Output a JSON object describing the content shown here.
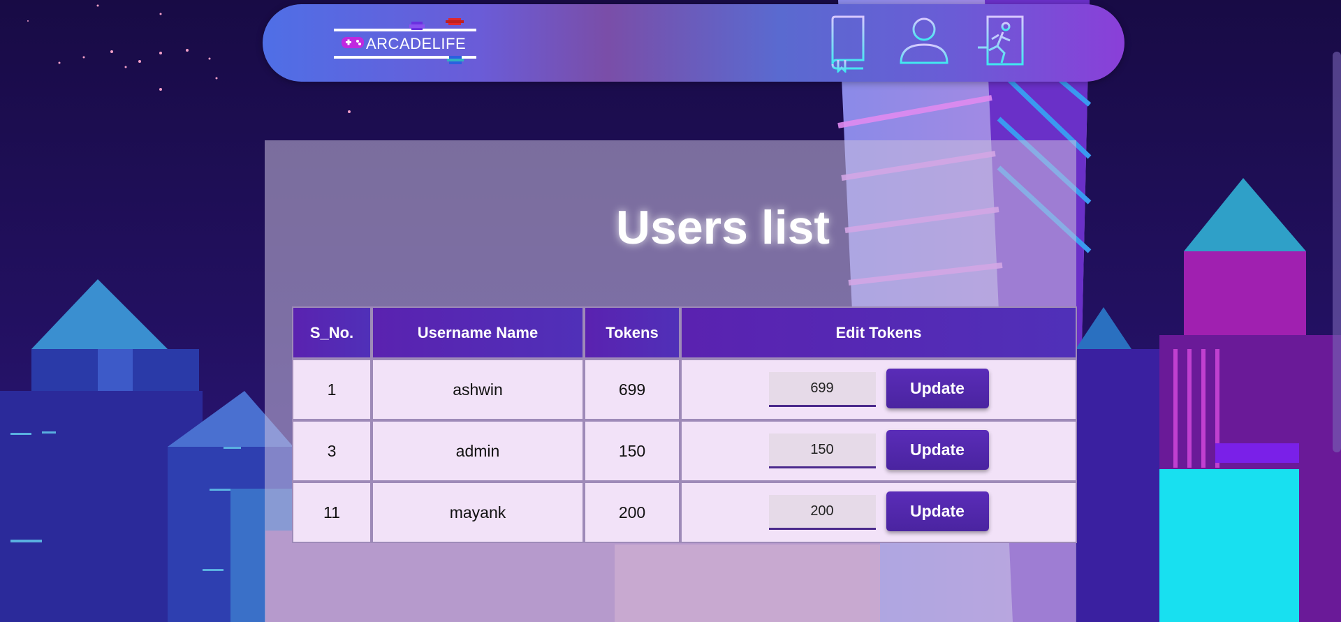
{
  "brand": {
    "name": "ARCADELIFE"
  },
  "nav": {
    "icons": [
      "book-icon",
      "user-icon",
      "logout-exit-icon"
    ]
  },
  "page": {
    "title": "Users list"
  },
  "table": {
    "headers": [
      "S_No.",
      "Username Name",
      "Tokens",
      "Edit Tokens"
    ],
    "rows": [
      {
        "sno": "1",
        "username": "ashwin",
        "tokens": "699",
        "input_value": "699",
        "button": "Update"
      },
      {
        "sno": "3",
        "username": "admin",
        "tokens": "150",
        "input_value": "150",
        "button": "Update"
      },
      {
        "sno": "11",
        "username": "mayank",
        "tokens": "200",
        "input_value": "200",
        "button": "Update"
      }
    ]
  },
  "colors": {
    "header_bg": "#5a22b0",
    "row_bg": "#f2e2f8",
    "button_bg": "#5a2cb8",
    "nav_gradient_start": "#4f6fe6",
    "nav_gradient_end": "#8a3fd8"
  }
}
